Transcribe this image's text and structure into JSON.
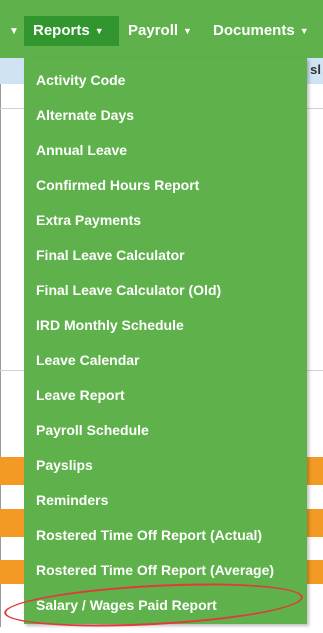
{
  "nav": {
    "items": [
      {
        "label": "Reports"
      },
      {
        "label": "Payroll"
      },
      {
        "label": "Documents"
      }
    ],
    "partial_text": "sl"
  },
  "reports_menu": {
    "items": [
      {
        "label": "Activity Code"
      },
      {
        "label": "Alternate Days"
      },
      {
        "label": "Annual Leave"
      },
      {
        "label": "Confirmed Hours Report"
      },
      {
        "label": "Extra Payments"
      },
      {
        "label": "Final Leave Calculator"
      },
      {
        "label": "Final Leave Calculator (Old)"
      },
      {
        "label": "IRD Monthly Schedule"
      },
      {
        "label": "Leave Calendar"
      },
      {
        "label": "Leave Report"
      },
      {
        "label": "Payroll Schedule"
      },
      {
        "label": "Payslips"
      },
      {
        "label": "Reminders"
      },
      {
        "label": "Rostered Time Off Report (Actual)"
      },
      {
        "label": "Rostered Time Off Report (Average)"
      },
      {
        "label": "Salary / Wages Paid Report"
      }
    ],
    "highlighted_item": "Salary / Wages Paid Report"
  },
  "colors": {
    "nav_green": "#5fb14b",
    "active_green": "#32962f",
    "highlight_red": "#e03a3a",
    "orange": "#f29a24"
  }
}
